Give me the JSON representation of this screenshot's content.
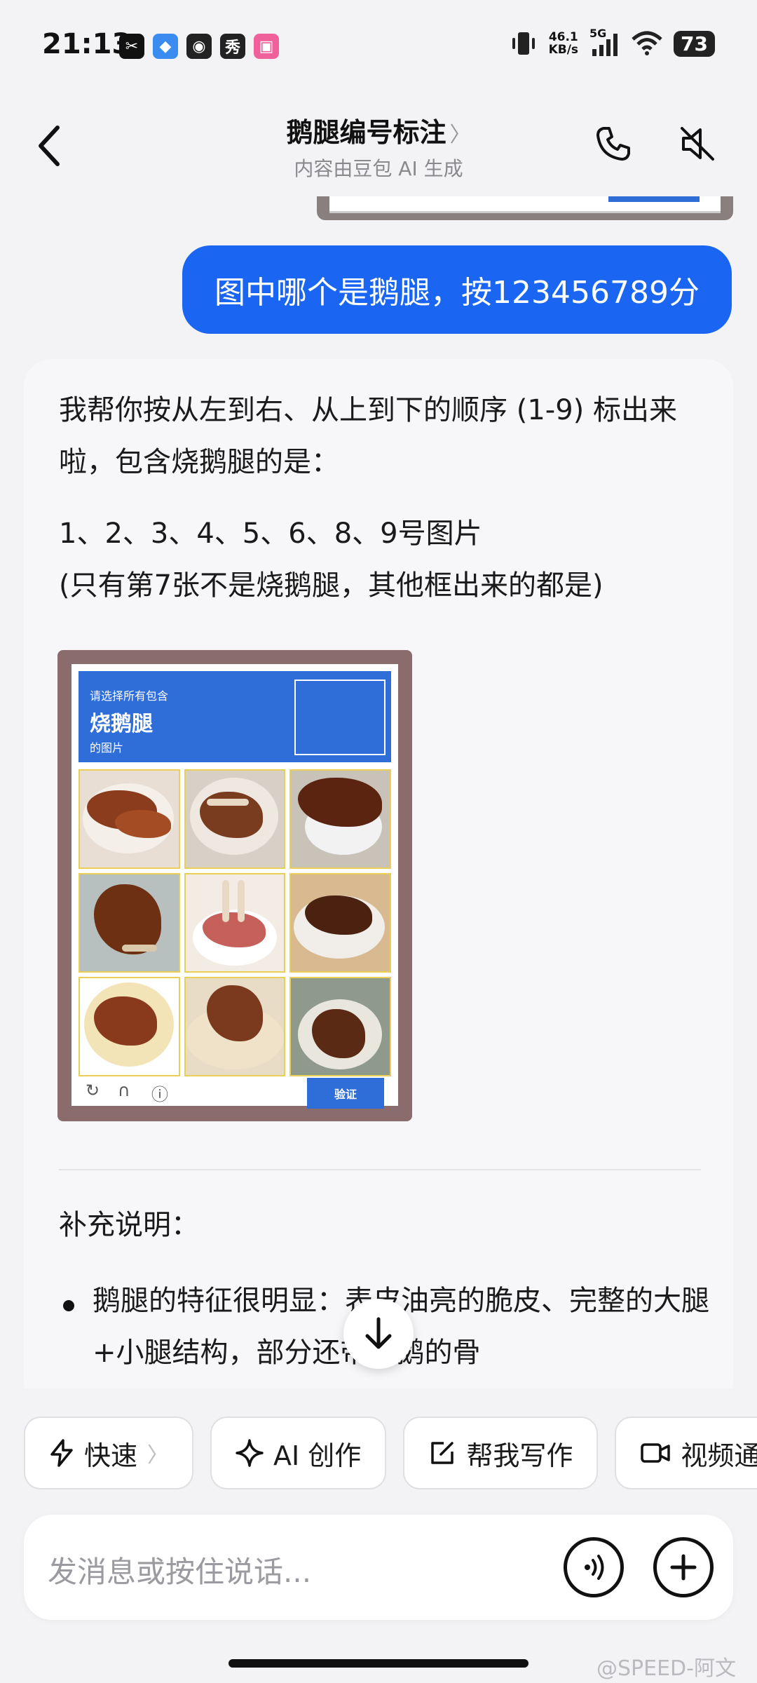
{
  "status_bar": {
    "time": "21:13",
    "apps": [
      {
        "name": "capcut-app-icon",
        "glyph": "✂",
        "color": "#111111"
      },
      {
        "name": "doubao-app-icon",
        "glyph": "◆",
        "color": "#3a8cf0"
      },
      {
        "name": "weibo-app-icon",
        "glyph": "◉",
        "color": "#222222"
      },
      {
        "name": "xiu-app-icon",
        "glyph": "秀",
        "color": "#222222"
      },
      {
        "name": "bilibili-app-icon",
        "glyph": "▣",
        "color": "#f0609a"
      }
    ],
    "net_speed_value": "46.1",
    "net_speed_unit": "KB/s",
    "signal_label": "5G",
    "battery": "73"
  },
  "header": {
    "title": "鹅腿编号标注",
    "title_chevron": "〉",
    "subtitle": "内容由豆包 AI 生成"
  },
  "user_message": "图中哪个是鹅腿，按123456789分",
  "ai_message": {
    "intro": "我帮你按从左到右、从上到下的顺序 (1-9) 标出来啦，包含烧鹅腿的是：",
    "answer_line1": "1、2、3、4、5、6、8、9号图片",
    "answer_line2": "(只有第7张不是烧鹅腿，其他框出来的都是)",
    "captcha": {
      "small_text": "请选择所有包含",
      "big_text": "烧鹅腿",
      "small_text2": "的图片",
      "verify_label": "验证"
    },
    "note_title": "补充说明：",
    "bullet_text": "鹅腿的特征很明显：表皮油亮的脆皮、完整的大腿+小腿结构，部分还带着鹅的骨"
  },
  "chips": [
    {
      "label": "快速",
      "icon": "lightning-icon",
      "chevron": "〉"
    },
    {
      "label": "AI 创作",
      "icon": "sparkle-icon"
    },
    {
      "label": "帮我写作",
      "icon": "edit-icon"
    },
    {
      "label": "视频通话",
      "icon": "video-icon"
    }
  ],
  "input": {
    "placeholder": "发消息或按住说话..."
  },
  "watermark": "@SPEED-阿文",
  "colors": {
    "accent_blue": "#1a66f2",
    "captcha_blue": "#2f6ed8"
  }
}
